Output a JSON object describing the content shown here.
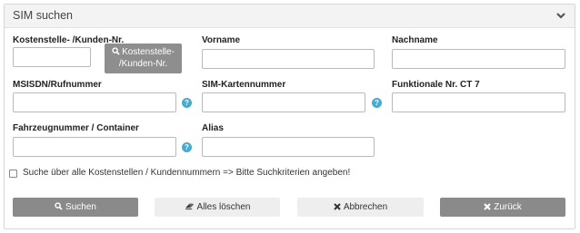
{
  "panel": {
    "title": "SIM suchen",
    "icon": "chevron-down-icon"
  },
  "fields": {
    "kostenstelle": {
      "label": "Kostenstelle- /Kunden-Nr.",
      "value": "",
      "placeholder": ""
    },
    "vorname": {
      "label": "Vorname",
      "value": "",
      "placeholder": ""
    },
    "nachname": {
      "label": "Nachname",
      "value": "",
      "placeholder": ""
    },
    "msisdn": {
      "label": "MSISDN/Rufnummer",
      "value": "",
      "placeholder": ""
    },
    "sim": {
      "label": "SIM-Kartennummer",
      "value": "",
      "placeholder": ""
    },
    "funktional": {
      "label": "Funktionale Nr. CT 7",
      "value": "",
      "placeholder": ""
    },
    "fahrzeug": {
      "label": "Fahrzeugnummer / Container",
      "value": "",
      "placeholder": ""
    },
    "alias": {
      "label": "Alias",
      "value": "",
      "placeholder": ""
    }
  },
  "kostenstelle_button": {
    "line1": "Kostenstelle-",
    "line2": "/Kunden-Nr.",
    "icon": "search-icon"
  },
  "help_icon": "?",
  "checkbox": {
    "label": "Suche über alle Kostenstellen / Kundennummern => Bitte Suchkriterien angeben!",
    "checked": false
  },
  "actions": {
    "search": {
      "label": "Suchen",
      "icon": "search-icon"
    },
    "clear": {
      "label": "Alles löschen",
      "icon": "eraser-icon"
    },
    "cancel": {
      "label": "Abbrechen",
      "icon": "close-icon"
    },
    "back": {
      "label": "Zurück",
      "icon": "close-icon"
    }
  },
  "colors": {
    "button_dark": "#8a8a8a",
    "button_light": "#eeeeee",
    "help": "#47aacf",
    "header": "#f3f3f3"
  }
}
